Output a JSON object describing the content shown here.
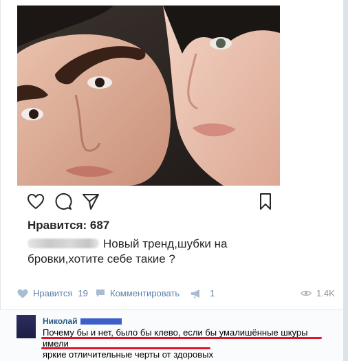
{
  "post": {
    "likes_label": "Нравится: 687",
    "caption": "Новый тренд,шубки на бровки,хотите себе такие ?"
  },
  "footer": {
    "like_label": "Нравится",
    "like_count": "19",
    "comment_label": "Комментировать",
    "share_count": "1",
    "views": "1.4K"
  },
  "comment": {
    "author": "Николай",
    "text_line1": "Почему бы и нет, было бы клево, если бы умалишённые шкуры имели",
    "text_line2": "яркие отличительные черты от здоровых"
  },
  "colors": {
    "vk_link": "#5e81a8",
    "vk_author": "#2a5885",
    "underline": "#e1152a"
  },
  "icons": [
    "heart-icon",
    "comment-icon",
    "send-icon",
    "bookmark-icon",
    "like-heart-icon",
    "comment-bubble-icon",
    "megaphone-icon",
    "eye-icon"
  ]
}
